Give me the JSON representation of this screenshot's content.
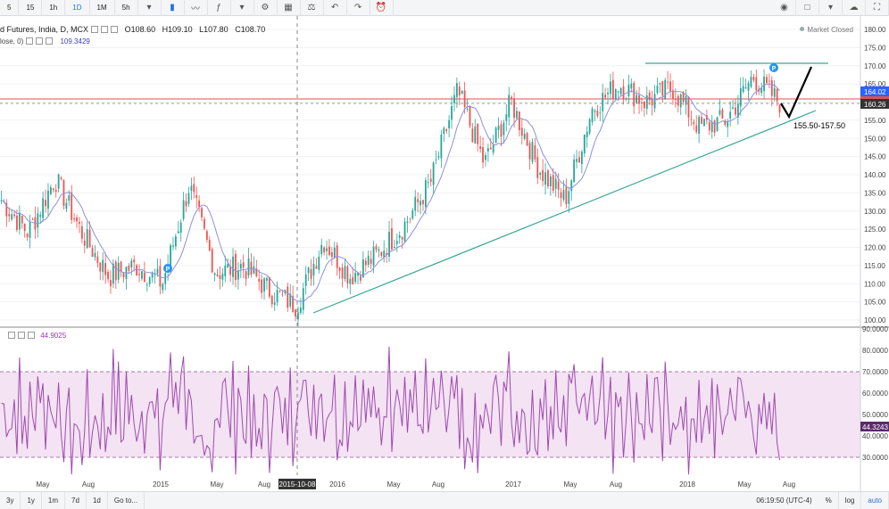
{
  "toolbar": {
    "intervals": [
      "5",
      "15",
      "1h",
      "1D",
      "1M",
      "5h"
    ],
    "active_interval": "1D",
    "icons": [
      "candles-icon",
      "line-chart-icon",
      "indicators-icon",
      "settings-icon",
      "compare-icon",
      "scale-icon",
      "undo-icon",
      "redo-icon",
      "alert-icon",
      "camera-icon",
      "layout-icon",
      "cloud-icon",
      "fullscreen-icon"
    ]
  },
  "legend": {
    "symbol": "d Futures, India, D, MCX",
    "open": "O108.60",
    "high": "H109.10",
    "low": "L107.80",
    "close": "C108.70",
    "ma_label": "lose, 0)",
    "ma_value": "109.3429"
  },
  "status": "Market Closed",
  "price_tags": {
    "upper": "164.02",
    "lower": "160.26"
  },
  "annotation": "155.50-157.50",
  "rsi": {
    "value_label": "44.9025",
    "current_tag": "44.3243"
  },
  "bottombar": {
    "ranges": [
      "3y",
      "1y",
      "1m",
      "7d",
      "1d",
      "Go to..."
    ],
    "time": "06:19:50 (UTC-4)",
    "right": [
      "%",
      "log",
      "auto"
    ]
  },
  "chart_data": [
    {
      "type": "candlestick",
      "series": [
        {
          "name": "",
          "values": []
        }
      ],
      "x_ticks": [
        "May",
        "Aug",
        "2015",
        "May",
        "Aug",
        "2015-10-08",
        "2016",
        "May",
        "Aug",
        "2017",
        "May",
        "Aug",
        "2018",
        "May",
        "Aug"
      ],
      "y_ticks": [
        "180.00",
        "175.00",
        "170.00",
        "165.00",
        "160.00",
        "155.00",
        "150.00",
        "145.00",
        "140.00",
        "135.00",
        "130.00",
        "125.00",
        "120.00",
        "115.00",
        "110.00",
        "105.00",
        "100.00"
      ],
      "ylim": [
        100,
        180
      ],
      "approx_close_path": [
        [
          "2014-04",
          133
        ],
        [
          "2014-06",
          124
        ],
        [
          "2014-08",
          139
        ],
        [
          "2014-10",
          124
        ],
        [
          "2014-12",
          112
        ],
        [
          "2015-01",
          115
        ],
        [
          "2015-03",
          110
        ],
        [
          "2015-05",
          137
        ],
        [
          "2015-07",
          113
        ],
        [
          "2015-08",
          115
        ],
        [
          "2015-10",
          108
        ],
        [
          "2015-12",
          104
        ],
        [
          "2016-02",
          122
        ],
        [
          "2016-04",
          112
        ],
        [
          "2016-06",
          118
        ],
        [
          "2016-08",
          126
        ],
        [
          "2016-10",
          138
        ],
        [
          "2016-12",
          163
        ],
        [
          "2017-01",
          143
        ],
        [
          "2017-02",
          160
        ],
        [
          "2017-04",
          142
        ],
        [
          "2017-06",
          133
        ],
        [
          "2017-08",
          158
        ],
        [
          "2017-10",
          165
        ],
        [
          "2017-12",
          160
        ],
        [
          "2018-02",
          164
        ],
        [
          "2018-03",
          153
        ],
        [
          "2018-05",
          155
        ],
        [
          "2018-06",
          167
        ],
        [
          "2018-07",
          160
        ]
      ]
    },
    {
      "type": "line",
      "series": [
        {
          "name": "",
          "values": []
        }
      ],
      "y_ticks": [
        "90.0000",
        "80.0000",
        "70.0000",
        "60.0000",
        "50.0000",
        "40.0000",
        "30.0000"
      ],
      "ylim": [
        25,
        90
      ],
      "bands": [
        30,
        70
      ]
    }
  ]
}
